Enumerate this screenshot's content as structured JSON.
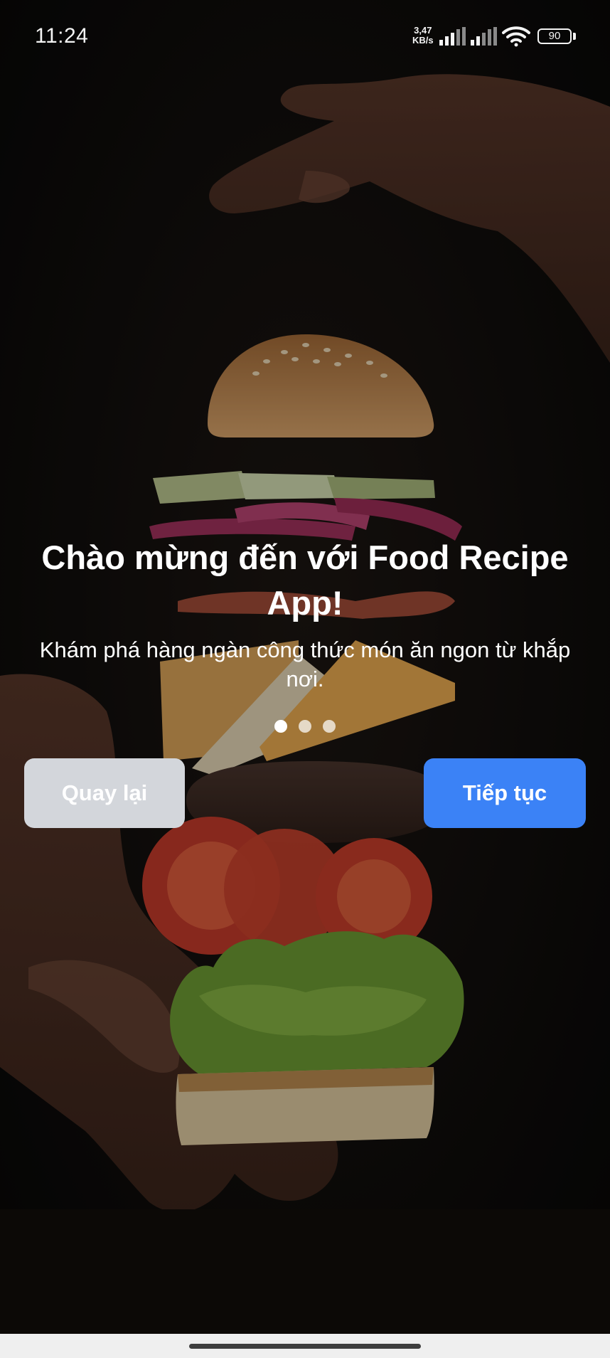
{
  "status_bar": {
    "time": "11:24",
    "network_speed_value": "3,47",
    "network_speed_unit": "KB/s",
    "battery_level": "90",
    "icons": [
      "signal-icon",
      "signal-icon",
      "wifi-icon",
      "battery-icon"
    ]
  },
  "background": {
    "image": "burger-ingredients-falling-between-hands-photo"
  },
  "onboarding": {
    "title": "Chào mừng đến với Food Recipe App!",
    "subtitle": "Khám phá hàng ngàn công thức món ăn ngon từ khắp nơi.",
    "page_indicator": {
      "total": 3,
      "current": 1
    },
    "back_label": "Quay lại",
    "next_label": "Tiếp tục"
  },
  "colors": {
    "primary": "#3b82f6",
    "back_button": "#d3d6db",
    "text": "#ffffff"
  }
}
